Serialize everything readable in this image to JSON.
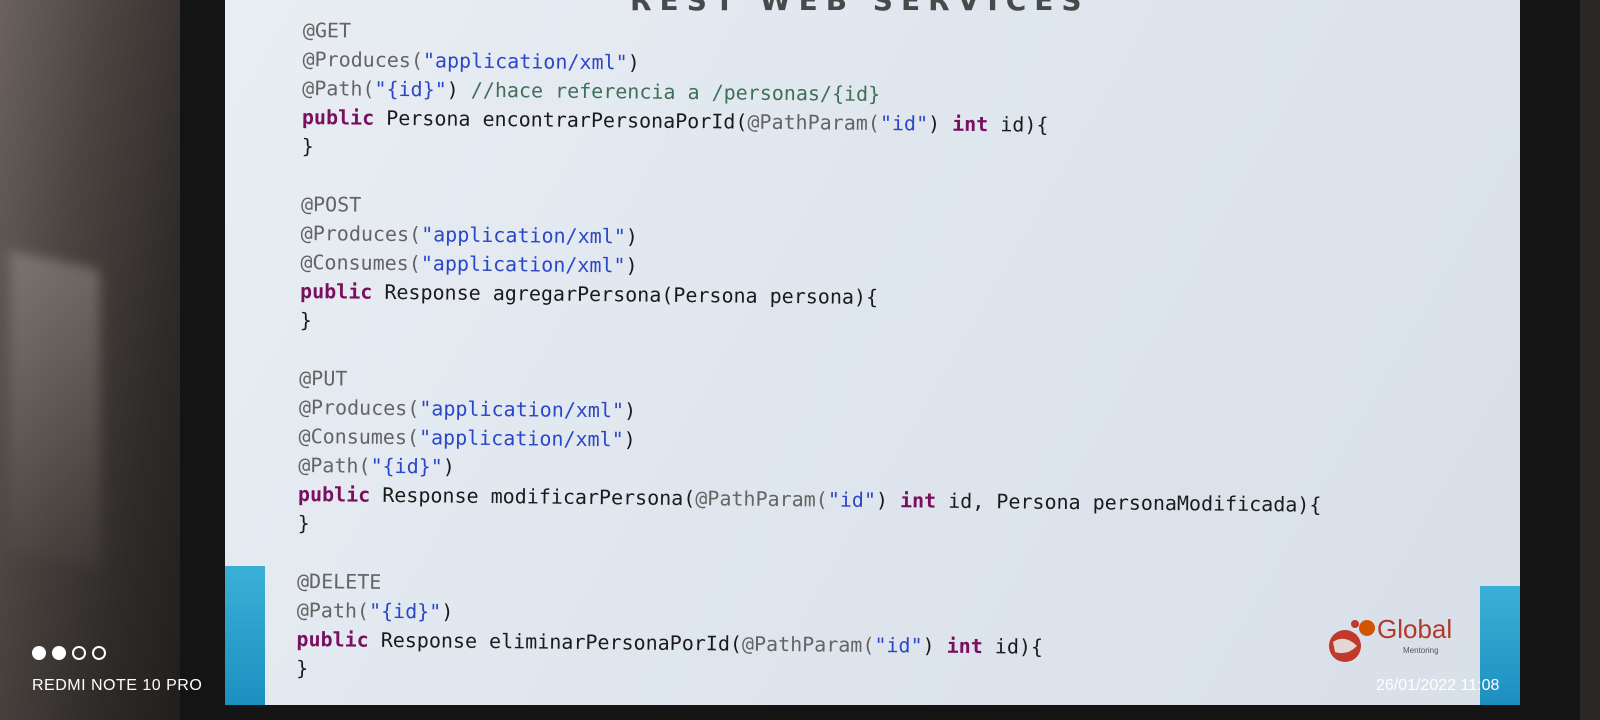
{
  "colors": {
    "keyword": "#7a0f5f",
    "annotation": "#646464",
    "string": "#2a47c8",
    "plain": "#1a1a1a",
    "accent_blue": "#1c8fbf"
  },
  "slide": {
    "title_cut": "REST WEB SERVICES"
  },
  "code": {
    "get": {
      "l1": {
        "ann": "@GET"
      },
      "l2": {
        "a": "@Produces(",
        "s": "\"application/xml\"",
        "b": ")"
      },
      "l3": {
        "a": "@Path(",
        "s": "\"{id}\"",
        "b": ") ",
        "c": "//hace referencia a /personas/{id}"
      },
      "l4": {
        "kw": "public",
        "rest1": " Persona encontrarPersonaPorId(",
        "a": "@PathParam(",
        "s": "\"id\"",
        "b": ") ",
        "kw2": "int",
        "rest2": " id){"
      },
      "l5": {
        "brace": "}"
      }
    },
    "post": {
      "l1": {
        "ann": "@POST"
      },
      "l2": {
        "a": "@Produces(",
        "s": "\"application/xml\"",
        "b": ")"
      },
      "l3": {
        "a": "@Consumes(",
        "s": "\"application/xml\"",
        "b": ")"
      },
      "l4": {
        "kw": "public",
        "rest": " Response agregarPersona(Persona persona){"
      },
      "l5": {
        "brace": "}"
      }
    },
    "put": {
      "l1": {
        "ann": "@PUT"
      },
      "l2": {
        "a": "@Produces(",
        "s": "\"application/xml\"",
        "b": ")"
      },
      "l3": {
        "a": "@Consumes(",
        "s": "\"application/xml\"",
        "b": ")"
      },
      "l4": {
        "a": "@Path(",
        "s": "\"{id}\"",
        "b": ")"
      },
      "l5": {
        "kw": "public",
        "rest1": " Response modificarPersona(",
        "a": "@PathParam(",
        "s": "\"id\"",
        "b": ") ",
        "kw2": "int",
        "rest2": " id, Persona personaModificada){"
      },
      "l6": {
        "brace": "}"
      }
    },
    "delete": {
      "l1": {
        "ann": "@DELETE"
      },
      "l2": {
        "a": "@Path(",
        "s": "\"{id}\"",
        "b": ")"
      },
      "l3": {
        "kw": "public",
        "rest1": " Response eliminarPersonaPorId(",
        "a": "@PathParam(",
        "s": "\"id\"",
        "b": ") ",
        "kw2": "int",
        "rest2": " id){"
      },
      "l4": {
        "brace": "}"
      }
    }
  },
  "logo": {
    "text": "Global",
    "sub": "Mentoring"
  },
  "watermark": {
    "device": "REDMI NOTE 10 PRO",
    "datetime": "26/01/2022 11:08"
  }
}
